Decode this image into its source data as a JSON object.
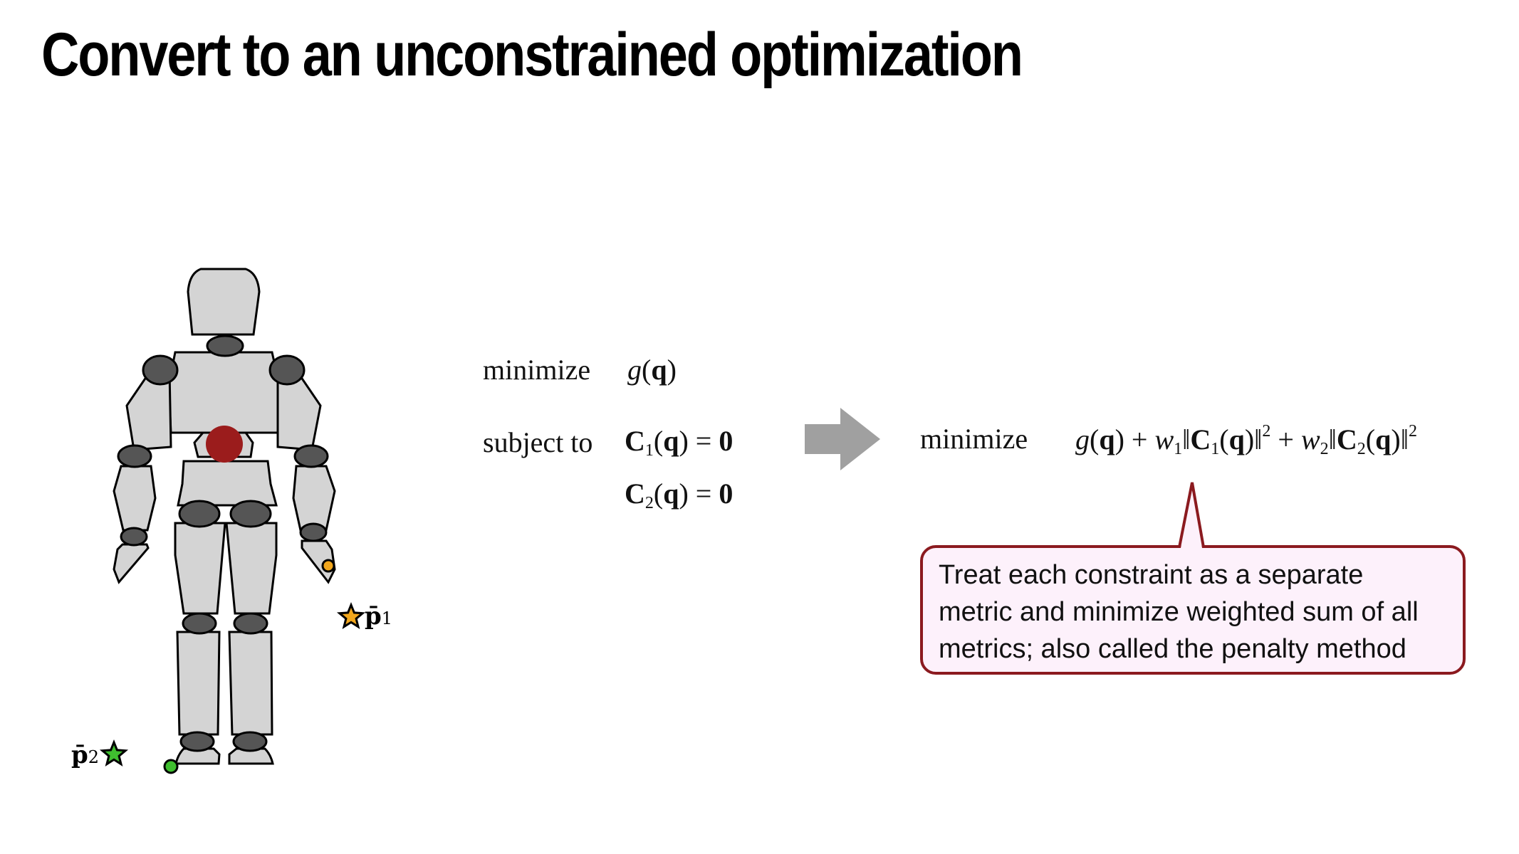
{
  "slide": {
    "title": "Convert to an unconstrained optimization"
  },
  "figure": {
    "target_points": [
      {
        "symbol": "p̄",
        "index": "1",
        "color": "#f2a71d"
      },
      {
        "symbol": "p̄",
        "index": "2",
        "color": "#3fbf2f"
      }
    ],
    "colors": {
      "body": "#d4d4d4",
      "joints": "#555555",
      "root": "#9b1c1c",
      "end_effector_hand": "#f2a71d",
      "end_effector_foot": "#3fbf2f"
    }
  },
  "problem_constrained": {
    "minimize_word": "minimize",
    "objective": {
      "fn": "g",
      "open": "(",
      "arg": "q",
      "close": ")"
    },
    "subject_to_word": "subject to",
    "constraints": [
      {
        "name": "C",
        "index": "1",
        "open": "(",
        "arg": "q",
        "close": ")",
        "rel": " = ",
        "rhs": "0"
      },
      {
        "name": "C",
        "index": "2",
        "open": "(",
        "arg": "q",
        "close": ")",
        "rel": " = ",
        "rhs": "0"
      }
    ]
  },
  "arrow": {
    "color": "#a0a0a0"
  },
  "problem_unconstrained": {
    "minimize_word": "minimize",
    "g_fn": "g",
    "paren_open": "(",
    "q": "q",
    "paren_close_plus": ") + ",
    "w": "w",
    "w1_index": "1",
    "norm_open": "‖",
    "C": "C",
    "C1_index": "1",
    "norm_close": ")‖",
    "squared": "2",
    "plus": " + ",
    "w2_index": "2",
    "C2_index": "2"
  },
  "callout": {
    "lines": [
      "Treat each constraint as a separate",
      "metric and minimize weighted sum of all",
      "metrics; also called the penalty method"
    ],
    "border_color": "#8b1a1f",
    "fill_color": "#fdf1fb"
  }
}
